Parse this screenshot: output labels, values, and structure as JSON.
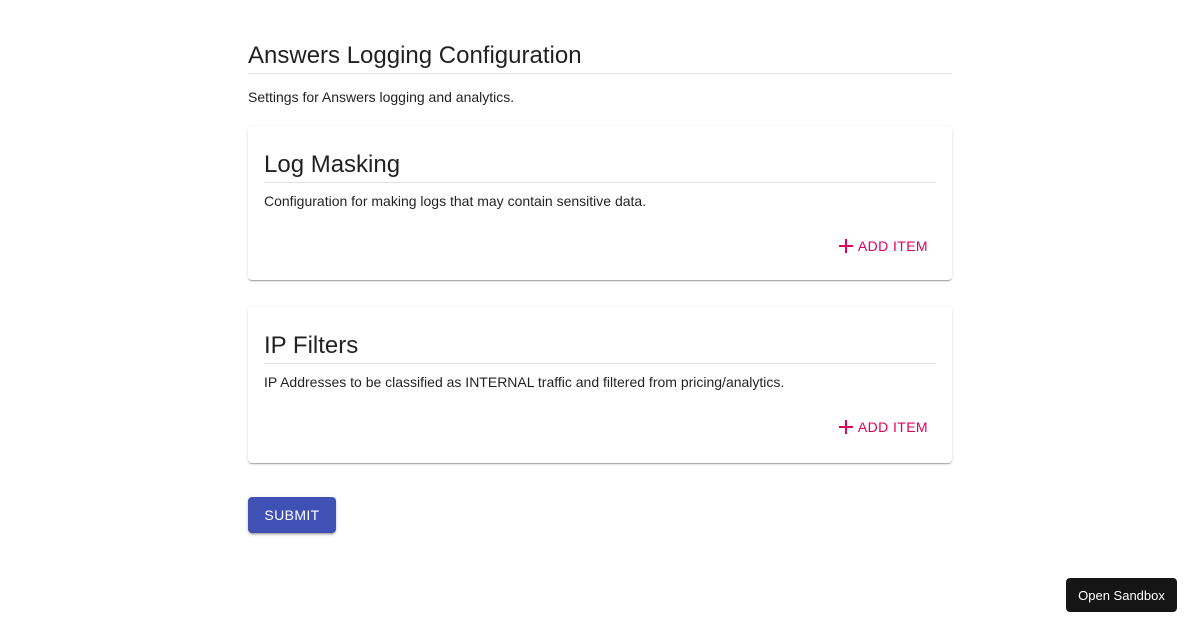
{
  "page": {
    "title": "Answers Logging Configuration",
    "description": "Settings for Answers logging and analytics."
  },
  "sections": [
    {
      "title": "Log Masking",
      "description": "Configuration for making logs that may contain sensitive data.",
      "add_label": "ADD ITEM"
    },
    {
      "title": "IP Filters",
      "description": "IP Addresses to be classified as INTERNAL traffic and filtered from pricing/analytics.",
      "add_label": "ADD ITEM"
    }
  ],
  "actions": {
    "submit_label": "SUBMIT",
    "sandbox_label": "Open Sandbox"
  },
  "colors": {
    "accent": "#e0005a",
    "primary": "#3f51b5",
    "sandbox_bg": "#151515"
  },
  "icons": {
    "add": "plus-icon"
  }
}
